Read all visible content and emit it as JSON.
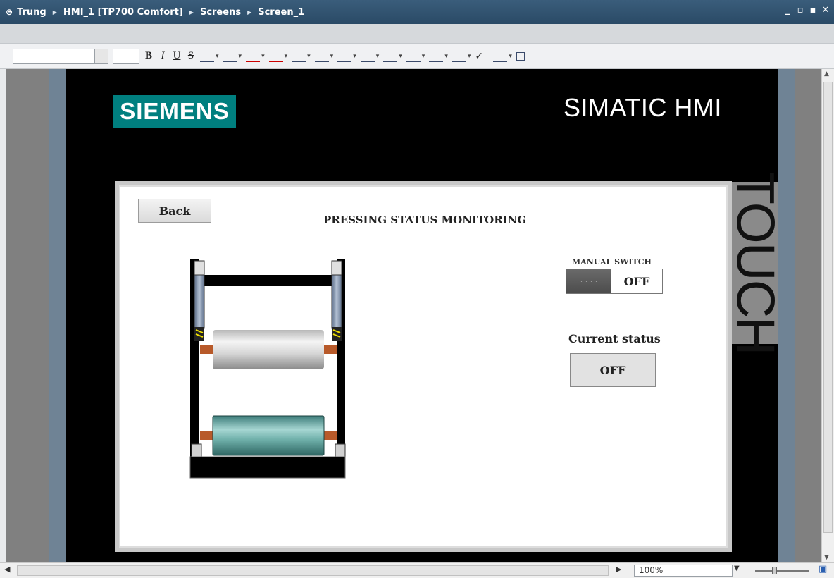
{
  "titlebar": {
    "breadcrumb": [
      "Trung",
      "HMI_1 [TP700 Comfort]",
      "Screens",
      "Screen_1"
    ]
  },
  "toolbar": {
    "items": [
      "B",
      "I",
      "U",
      "S"
    ]
  },
  "device": {
    "brand_logo": "SIEMENS",
    "product_name": "SIMATIC HMI",
    "side_label": "TOUCH"
  },
  "screen": {
    "back_label": "Back",
    "title": "PRESSING STATUS MONITORING",
    "manual_switch_label": "MANUAL SWITCH",
    "manual_switch_knob": "· · · ·",
    "manual_switch_value": "OFF",
    "current_status_label": "Current status",
    "current_status_value": "OFF"
  },
  "statusbar": {
    "zoom": "100%"
  },
  "colors": {
    "titlebar": "#2f5373",
    "siemens_teal": "#007f7f",
    "frame_blue": "#6f8395"
  }
}
